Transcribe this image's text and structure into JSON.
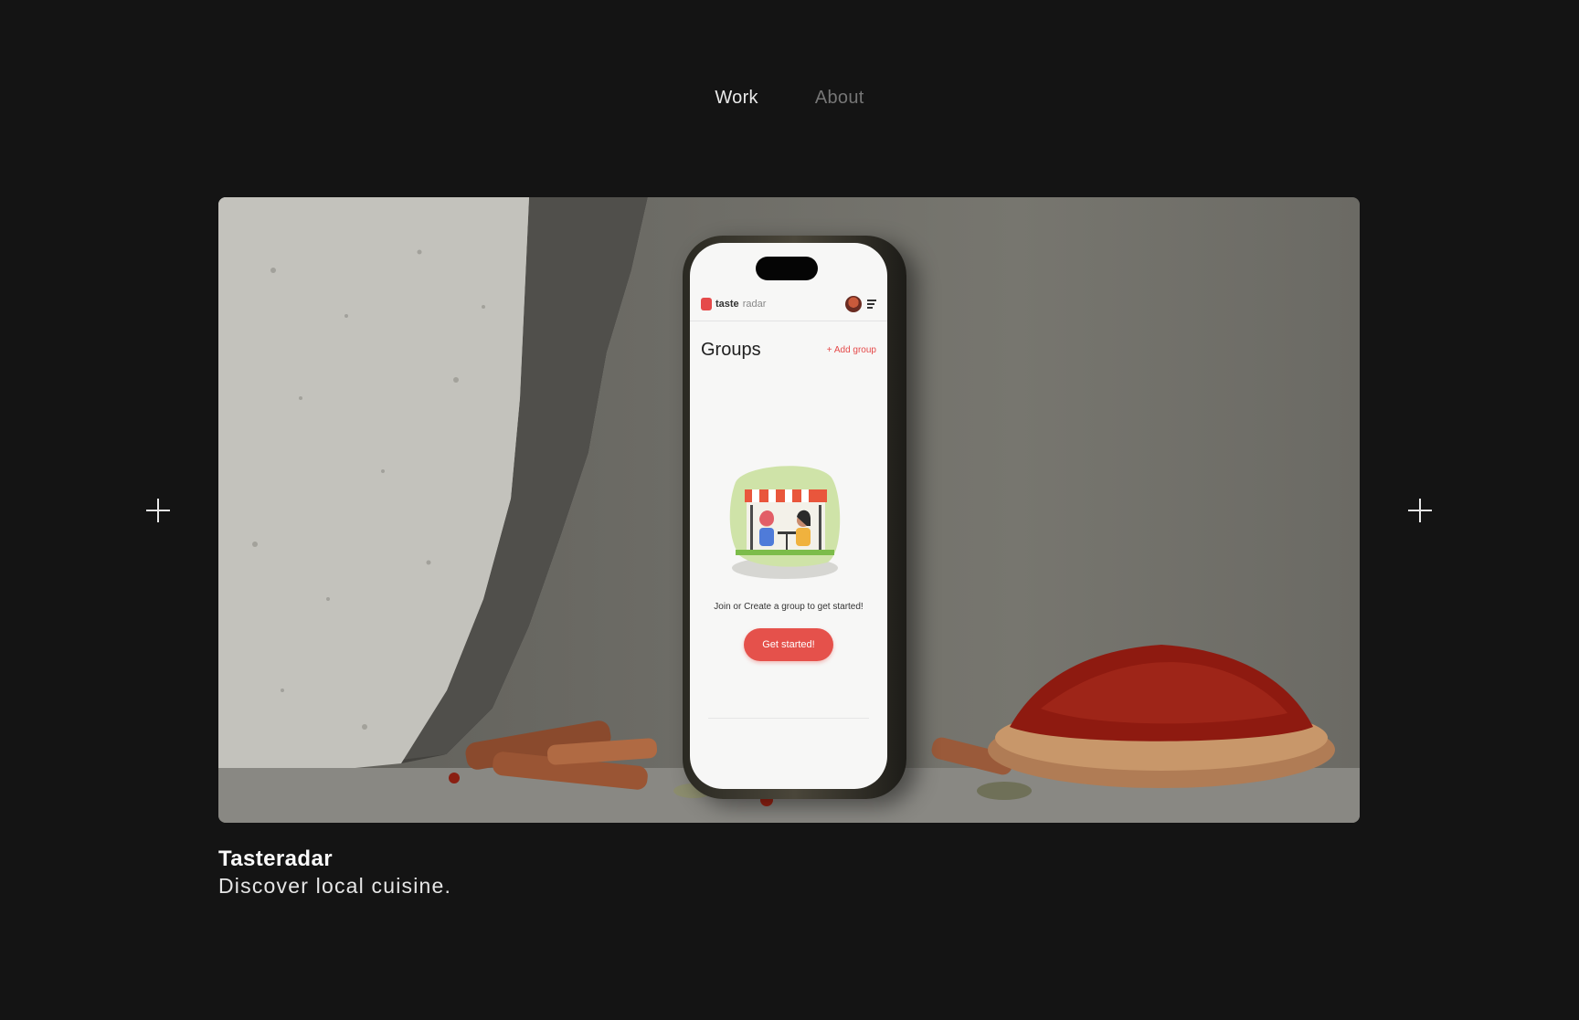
{
  "nav": {
    "items": [
      {
        "label": "Work",
        "active": true
      },
      {
        "label": "About",
        "active": false
      }
    ]
  },
  "hero": {
    "app": {
      "logo_bold": "taste",
      "logo_light": "radar",
      "title": "Groups",
      "add_group": "+ Add group",
      "prompt": "Join or Create a group to get started!",
      "cta": "Get started!"
    }
  },
  "project": {
    "title": "Tasteradar",
    "subtitle": "Discover local cuisine."
  },
  "colors": {
    "background": "#141414",
    "accent": "#e5514b"
  }
}
